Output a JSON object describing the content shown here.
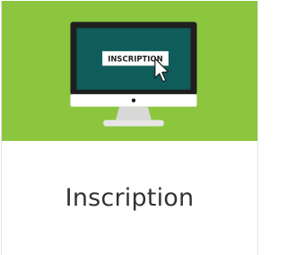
{
  "card": {
    "screen_button_label": "INSCRIPTION",
    "title": "Inscription"
  },
  "icons": {
    "illustration": "computer-monitor-icon",
    "cursor": "mouse-pointer-icon"
  },
  "colors": {
    "banner": "#8cc63f",
    "screen": "#0e5d5a",
    "monitor_frame": "#1f1f1f",
    "stand": "#dcdcdc",
    "title_text": "#333333"
  }
}
